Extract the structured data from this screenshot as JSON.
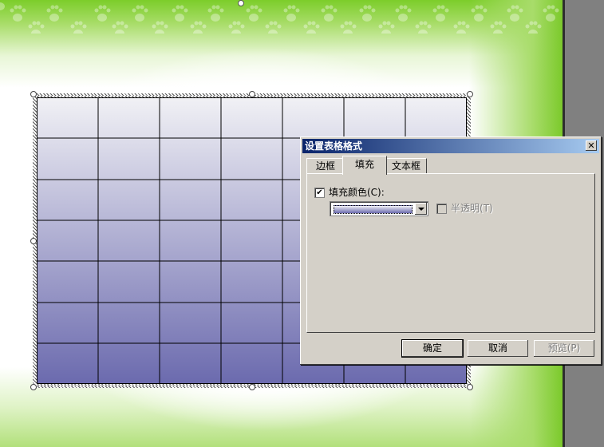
{
  "table": {
    "rows": 7,
    "cols": 7,
    "fill_top_color": "#f1f1f5",
    "fill_bottom_color": "#6b6aae",
    "line_color": "#000000"
  },
  "dialog": {
    "title": "设置表格格式",
    "close_glyph": "✕",
    "tabs": [
      {
        "label": "边框",
        "active": false
      },
      {
        "label": "填充",
        "active": true
      },
      {
        "label": "文本框",
        "active": false
      }
    ],
    "fill_color": {
      "checked": true,
      "label": "填充颜色(C):"
    },
    "semi_transparent": {
      "checked": false,
      "label": "半透明(T)",
      "enabled": false
    },
    "buttons": {
      "ok": "确定",
      "cancel": "取消",
      "preview": "预览(P)"
    }
  },
  "theme": {
    "slide_green": "#7ccd2a",
    "dialog_face": "#d4d0c8",
    "titlebar_start": "#0a246a",
    "titlebar_end": "#a6caf0"
  },
  "icons": {
    "paw": "paw-print-icon",
    "check": "checkmark-icon",
    "dropdown": "chevron-down-icon",
    "close": "close-icon"
  }
}
